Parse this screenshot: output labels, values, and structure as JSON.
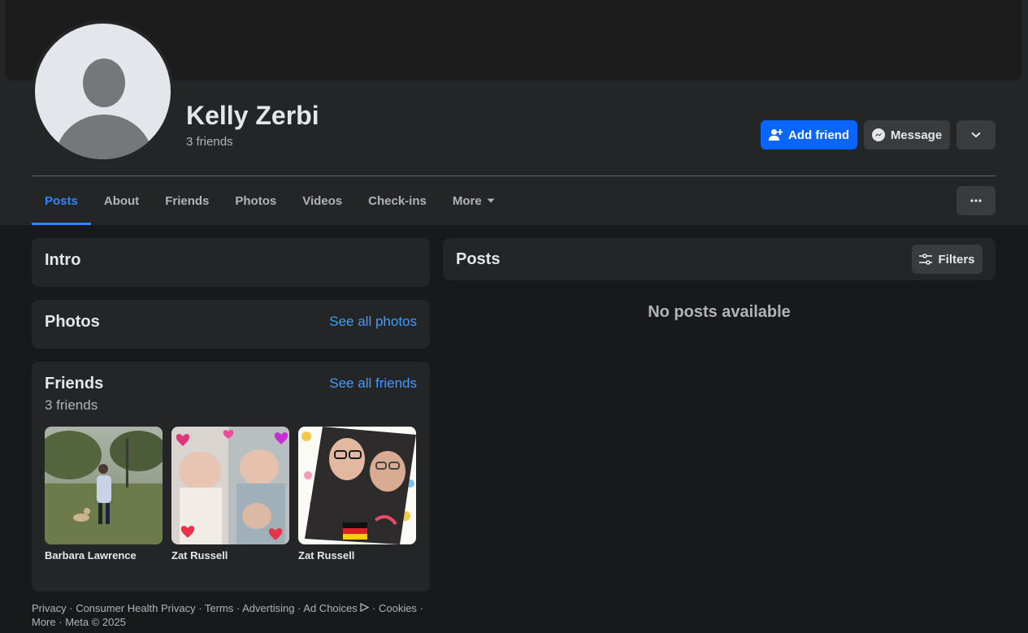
{
  "profile": {
    "name": "Kelly Zerbi",
    "friend_count": "3 friends"
  },
  "actions": {
    "add_friend": "Add friend",
    "message": "Message"
  },
  "tabs": [
    {
      "label": "Posts",
      "active": true
    },
    {
      "label": "About"
    },
    {
      "label": "Friends"
    },
    {
      "label": "Photos"
    },
    {
      "label": "Videos"
    },
    {
      "label": "Check-ins"
    },
    {
      "label": "More"
    }
  ],
  "intro": {
    "title": "Intro"
  },
  "photos": {
    "title": "Photos",
    "see_all": "See all photos"
  },
  "friends": {
    "title": "Friends",
    "count": "3 friends",
    "see_all": "See all friends",
    "items": [
      {
        "name": "Barbara Lawrence"
      },
      {
        "name": "Zat Russell"
      },
      {
        "name": "Zat Russell"
      }
    ]
  },
  "posts": {
    "title": "Posts",
    "filters": "Filters",
    "empty": "No posts available"
  },
  "footer": {
    "links": [
      "Privacy",
      "Consumer Health Privacy",
      "Terms",
      "Advertising",
      "Ad Choices",
      "Cookies",
      "More"
    ],
    "copyright": "Meta © 2025"
  },
  "colors": {
    "accent": "#0866ff",
    "link": "#4599ff",
    "surface": "#242526",
    "background": "#18191a"
  }
}
